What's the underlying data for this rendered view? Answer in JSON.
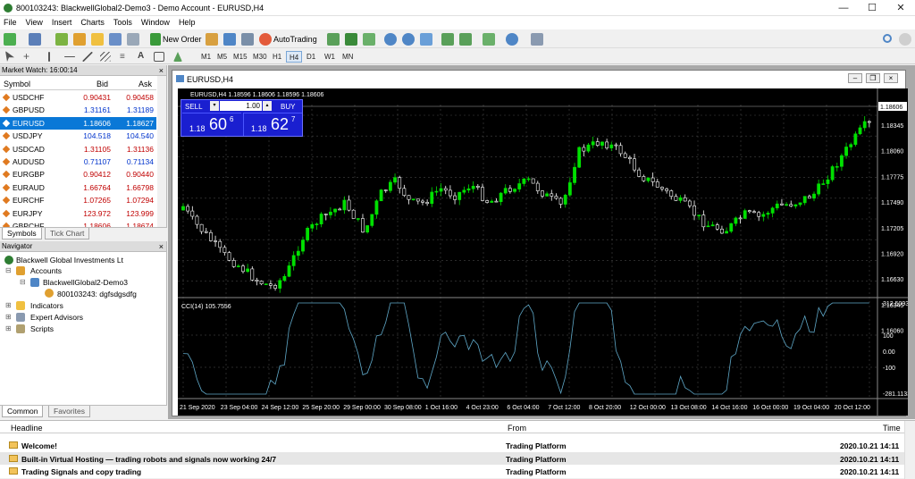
{
  "window": {
    "title": "800103243: BlackwellGlobal2-Demo3 - Demo Account - EURUSD,H4"
  },
  "menu": [
    "File",
    "View",
    "Insert",
    "Charts",
    "Tools",
    "Window",
    "Help"
  ],
  "toolbar": {
    "new_order": "New Order",
    "auto_trading": "AutoTrading"
  },
  "timeframes": [
    "M1",
    "M5",
    "M15",
    "M30",
    "H1",
    "H4",
    "D1",
    "W1",
    "MN"
  ],
  "timeframe_active": "H4",
  "market_watch": {
    "title": "Market Watch: 16:00:14",
    "col_symbol": "Symbol",
    "col_bid": "Bid",
    "col_ask": "Ask",
    "rows": [
      {
        "symbol": "USDCHF",
        "bid": "0.90431",
        "ask": "0.90458",
        "color": "red"
      },
      {
        "symbol": "GBPUSD",
        "bid": "1.31161",
        "ask": "1.31189",
        "color": "blue"
      },
      {
        "symbol": "EURUSD",
        "bid": "1.18606",
        "ask": "1.18627",
        "color": "sel"
      },
      {
        "symbol": "USDJPY",
        "bid": "104.518",
        "ask": "104.540",
        "color": "blue"
      },
      {
        "symbol": "USDCAD",
        "bid": "1.31105",
        "ask": "1.31136",
        "color": "red"
      },
      {
        "symbol": "AUDUSD",
        "bid": "0.71107",
        "ask": "0.71134",
        "color": "blue"
      },
      {
        "symbol": "EURGBP",
        "bid": "0.90412",
        "ask": "0.90440",
        "color": "red"
      },
      {
        "symbol": "EURAUD",
        "bid": "1.66764",
        "ask": "1.66798",
        "color": "red"
      },
      {
        "symbol": "EURCHF",
        "bid": "1.07265",
        "ask": "1.07294",
        "color": "red"
      },
      {
        "symbol": "EURJPY",
        "bid": "123.972",
        "ask": "123.999",
        "color": "red"
      },
      {
        "symbol": "GBPCHF",
        "bid": "1.18606",
        "ask": "1.18674",
        "color": "red"
      }
    ],
    "tabs": [
      "Symbols",
      "Tick Chart"
    ]
  },
  "navigator": {
    "title": "Navigator",
    "root": "Blackwell Global Investments Lt",
    "accounts": "Accounts",
    "server": "BlackwellGlobal2-Demo3",
    "account": "800103243: dgfsdgsdfg",
    "indicators": "Indicators",
    "experts": "Expert Advisors",
    "scripts": "Scripts",
    "tabs": [
      "Common",
      "Favorites"
    ]
  },
  "chart": {
    "window_title": "EURUSD,H4",
    "info": "EURUSD,H4  1.18596 1.18606 1.18596 1.18606",
    "sell_label": "SELL",
    "buy_label": "BUY",
    "lot": "1.00",
    "sell_prefix": "1.18",
    "sell_big": "60",
    "sell_sup": "6",
    "buy_prefix": "1.18",
    "buy_big": "62",
    "buy_sup": "7",
    "current_price": "1.18606",
    "price_labels": [
      "1.18345",
      "1.18060",
      "1.17775",
      "1.17490",
      "1.17205",
      "1.16920",
      "1.16630",
      "1.16345",
      "1.16060"
    ],
    "cci_title": "CCI(14) 105.7556",
    "cci_labels": [
      "312.5093",
      "100",
      "0.00",
      "-100",
      "-281.1133"
    ],
    "time_labels": [
      "21 Sep 2020",
      "23 Sep 04:00",
      "24 Sep 12:00",
      "25 Sep 20:00",
      "29 Sep 00:00",
      "30 Sep 08:00",
      "1 Oct 16:00",
      "4 Oct 23:00",
      "6 Oct 04:00",
      "7 Oct 12:00",
      "8 Oct 20:00",
      "12 Oct 00:00",
      "13 Oct 08:00",
      "14 Oct 16:00",
      "16 Oct 00:00",
      "19 Oct 04:00",
      "20 Oct 12:00"
    ],
    "colors": {
      "bull": "#00e000",
      "bear": "#ffffff",
      "cci": "#5fa8c8"
    }
  },
  "news": {
    "col_headline": "Headline",
    "col_from": "From",
    "col_time": "Time",
    "rows": [
      {
        "headline": "Welcome!",
        "from": "Trading Platform",
        "time": "2020.10.21 14:11"
      },
      {
        "headline": "Built-in Virtual Hosting — trading robots and signals now working 24/7",
        "from": "Trading Platform",
        "time": "2020.10.21 14:11"
      },
      {
        "headline": "Trading Signals and copy trading",
        "from": "Trading Platform",
        "time": "2020.10.21 14:11"
      }
    ]
  }
}
